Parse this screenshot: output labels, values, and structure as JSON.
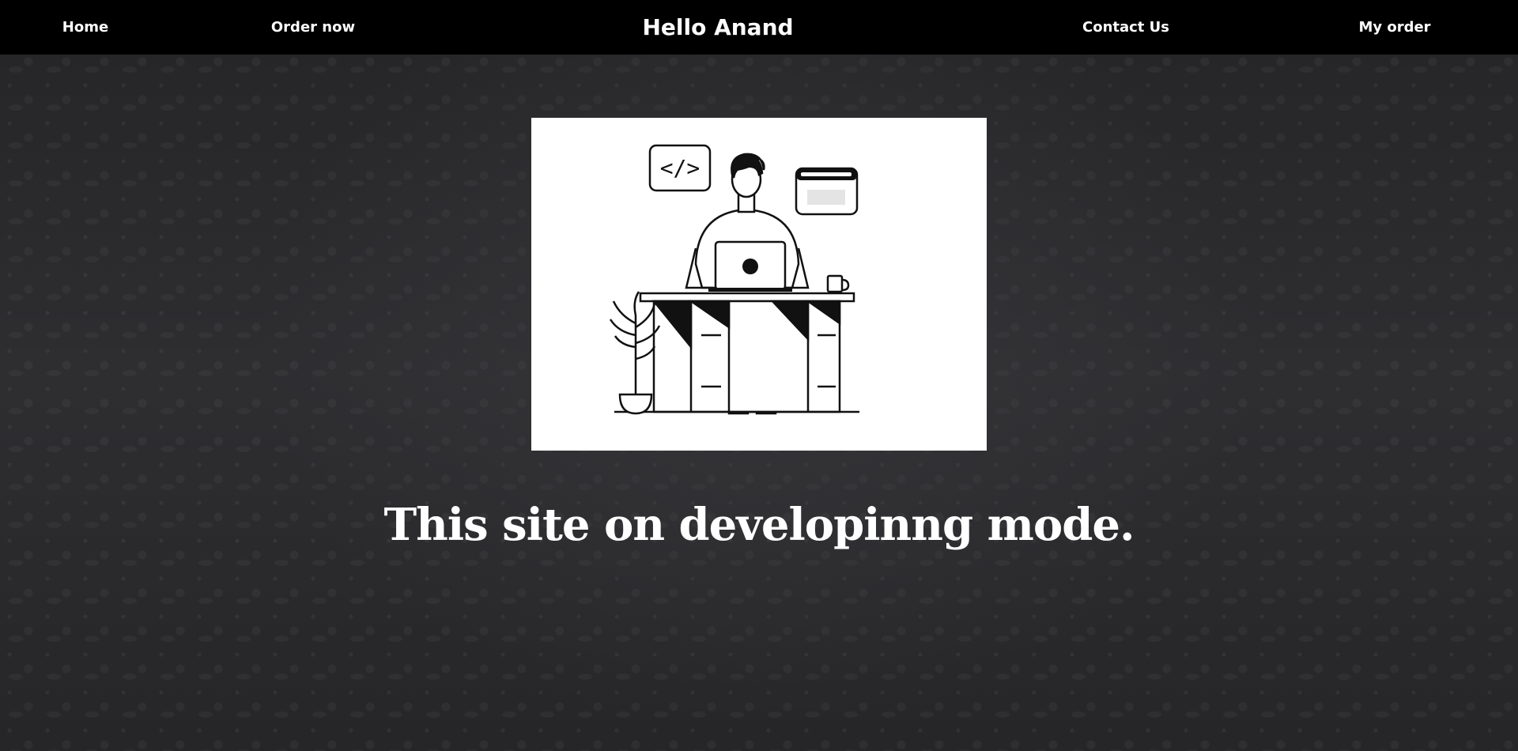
{
  "nav": {
    "home_label": "Home",
    "order_now_label": "Order now",
    "title": "Hello Anand",
    "contact_label": "Contact Us",
    "my_order_label": "My order"
  },
  "illustration": {
    "code_icon_text": "</>",
    "subject": "developer-at-desk-illustration"
  },
  "main": {
    "heading": "This site on developinng mode."
  },
  "colors": {
    "nav_background": "#000000",
    "page_background": "#2a2a2c",
    "text": "#ffffff",
    "card_background": "#ffffff"
  }
}
